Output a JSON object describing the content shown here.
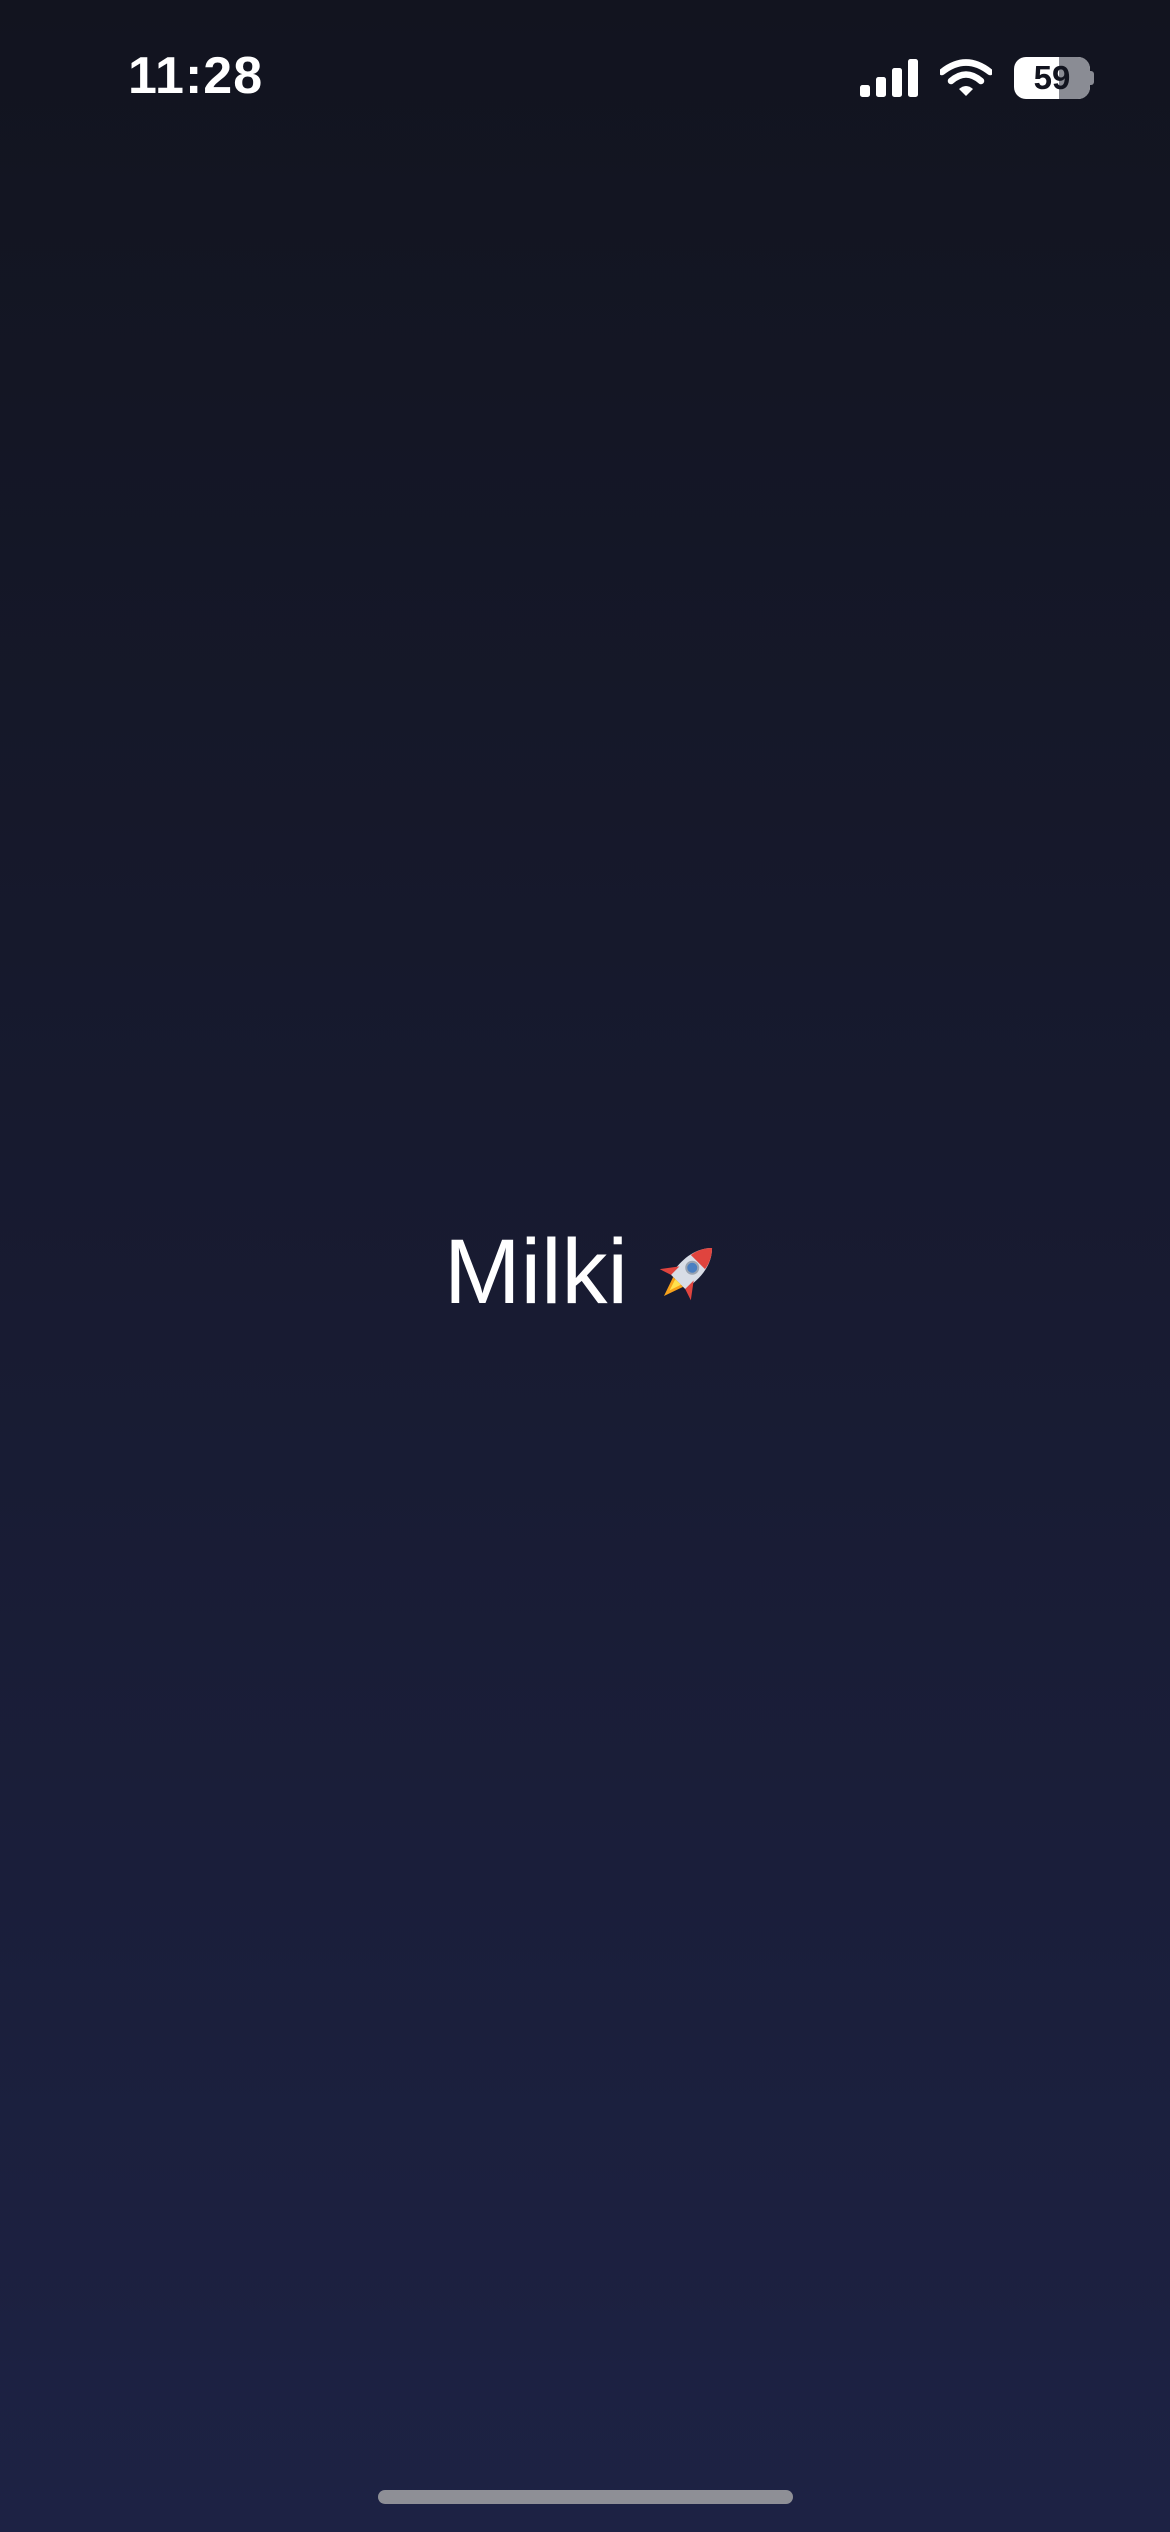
{
  "status_bar": {
    "time": "11:28",
    "battery_level": "59",
    "battery_fraction": 0.59,
    "icons": [
      "signal-icon",
      "wifi-icon",
      "battery-icon"
    ]
  },
  "splash": {
    "app_name": "Milki",
    "emoji_icon": "rocket-icon"
  },
  "colors": {
    "background_top": "#12141f",
    "background_bottom": "#1d2244",
    "text": "#ffffff",
    "home_indicator": "#8e8f96"
  }
}
